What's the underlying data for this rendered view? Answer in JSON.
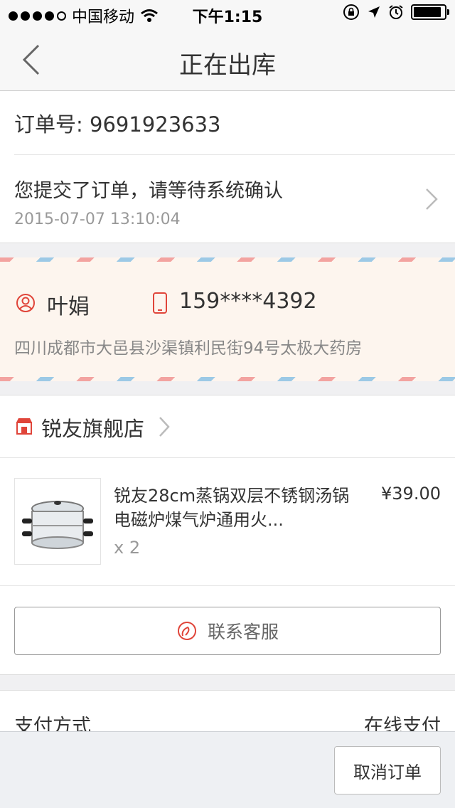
{
  "status_bar": {
    "carrier": "中国移动",
    "time": "下午1:15",
    "battery_level": 0.9
  },
  "nav": {
    "title": "正在出库",
    "back_icon": "chevron-left-icon"
  },
  "order": {
    "number_text": "订单号: 9691923633",
    "status_message": "您提交了订单，请等待系统确认",
    "status_time": "2015-07-07 13:10:04"
  },
  "address": {
    "name": "叶娟",
    "phone": "159****4392",
    "detail": "四川成都市大邑县沙渠镇利民街94号太极大药房"
  },
  "store": {
    "name": "锐友旗舰店",
    "product": {
      "title": "锐友28cm蒸锅双层不锈钢汤锅电磁炉煤气炉通用火...",
      "price": "¥39.00",
      "quantity": "x 2"
    },
    "contact_label": "联系客服"
  },
  "payment": {
    "label": "支付方式",
    "value": "在线支付"
  },
  "bottom": {
    "cancel_label": "取消订单"
  },
  "colors": {
    "accent_red": "#e0453a",
    "text_primary": "#333333",
    "text_secondary": "#999999",
    "address_bg": "#fdf5ee"
  }
}
